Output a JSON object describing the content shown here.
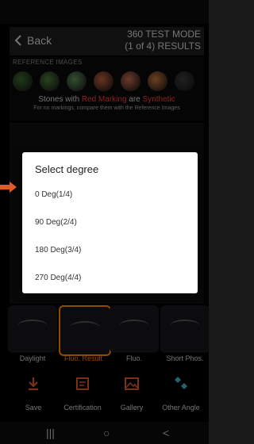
{
  "header": {
    "back_label": "Back",
    "mode_line1": "360 TEST MODE",
    "mode_line2": "(1 of 4) RESULTS"
  },
  "reference": {
    "label": "REFERENCE IMAGES",
    "swatches": [
      "#3f6a2f",
      "#4a7a38",
      "#5e8f5a",
      "#c0603e",
      "#c36b4f",
      "#c3743e",
      "#3b3b3b"
    ]
  },
  "stones_message": {
    "pre": "Stones with ",
    "highlight1": "Red Marking",
    "mid": " are ",
    "highlight2": "Synthetic",
    "small": "For no markings, compare them with the Reference Images"
  },
  "dialog": {
    "title": "Select degree",
    "options": [
      "0 Deg(1/4)",
      "90 Deg(2/4)",
      "180 Deg(3/4)",
      "270 Deg(4/4)"
    ]
  },
  "thumbnails": [
    {
      "label": "Daylight"
    },
    {
      "label": "Fluo. Result"
    },
    {
      "label": "Fluo."
    },
    {
      "label": "Short Phos."
    }
  ],
  "toolbar": {
    "save": "Save",
    "certification": "Certification",
    "gallery": "Gallery",
    "other_angle": "Other Angle"
  },
  "navbar": {
    "recents": "|||",
    "home": "○",
    "back": "<"
  },
  "colors": {
    "accent": "#ff8a00",
    "tool_icon": "#e05a2b",
    "red_text": "#ff3b3b",
    "dialog_bg": "#ffffff"
  }
}
